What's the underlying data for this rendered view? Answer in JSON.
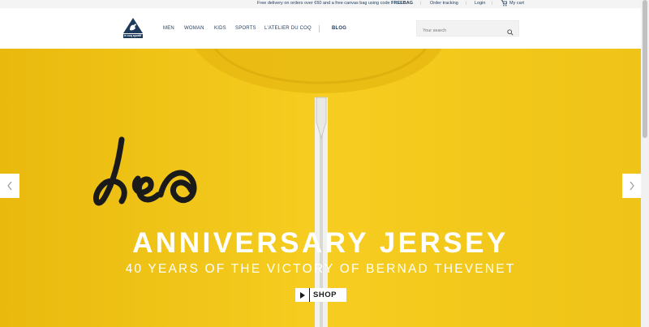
{
  "topbar": {
    "promo_text": "Free delivery on orders over €60 and a free canvas bag using code ",
    "promo_code": "FREEBAG",
    "order_tracking": "Order tracking",
    "login": "Login",
    "cart": "My cart"
  },
  "brand": {
    "logo_text": "le coq sportif"
  },
  "nav": {
    "items": [
      "MEN",
      "WOMAN",
      "KIDS",
      "SPORTS",
      "L'ATELIER DU COQ"
    ],
    "blog": "BLOG"
  },
  "search": {
    "placeholder": "Your search",
    "icon": "search-icon"
  },
  "hero": {
    "title": "ANNIVERSARY JERSEY",
    "subtitle": "40 YEARS OF THE VICTORY OF BERNAD THEVENET",
    "cta": "SHOP",
    "background_color": "#f2c516",
    "prev_icon": "chevron-left-icon",
    "next_icon": "chevron-right-icon"
  },
  "colors": {
    "brand_navy": "#1d3a5c",
    "hero_yellow": "#f2c516"
  }
}
